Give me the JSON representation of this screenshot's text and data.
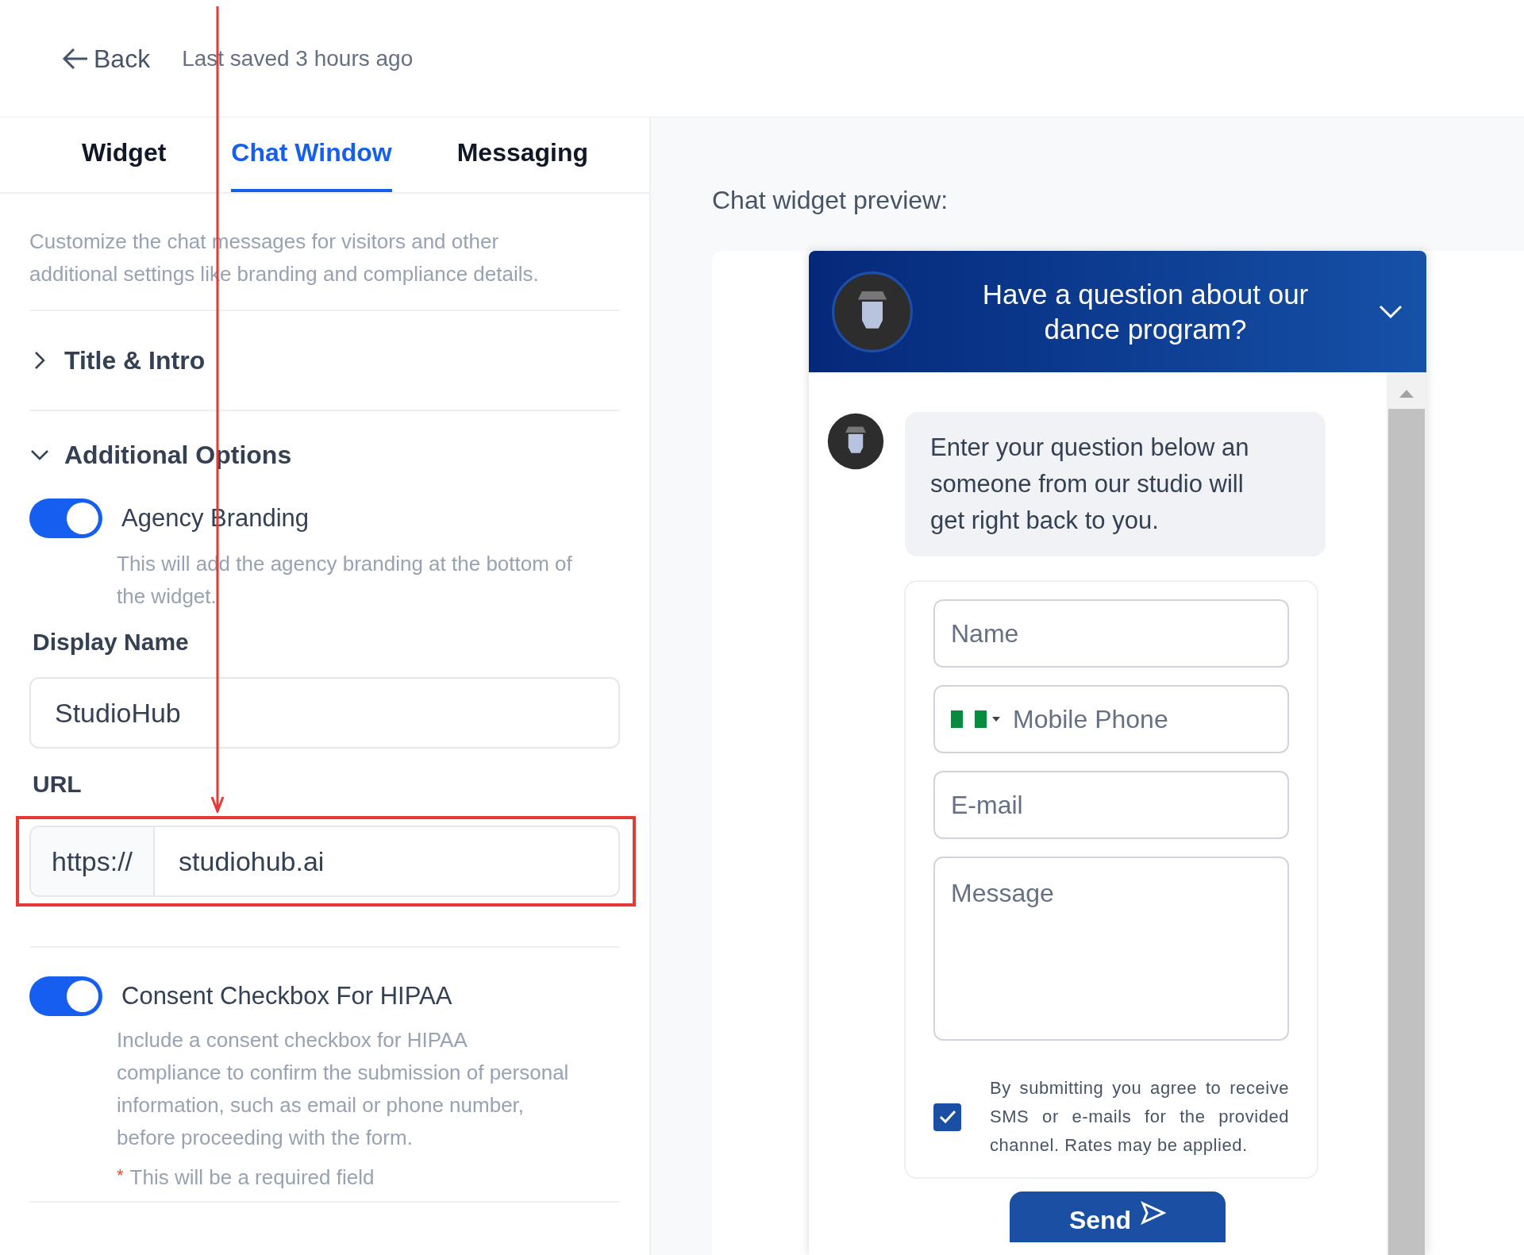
{
  "header": {
    "back": "Back",
    "saved": "Last saved 3 hours ago"
  },
  "tabs": [
    {
      "label": "Widget",
      "selected": false
    },
    {
      "label": "Chat Window",
      "selected": true
    },
    {
      "label": "Messaging",
      "selected": false
    }
  ],
  "intro": "Customize the chat messages for visitors and other additional settings like branding and compliance details.",
  "sections": [
    {
      "title": "Title & Intro",
      "expanded": false
    },
    {
      "title": "Additional Options",
      "expanded": true
    }
  ],
  "agency_branding": {
    "label": "Agency Branding",
    "on": true,
    "description": "This will add the agency branding at the bottom of the widget."
  },
  "display_name": {
    "label": "Display Name",
    "value": "StudioHub"
  },
  "url": {
    "label": "URL",
    "prefix": "https://",
    "value": "studiohub.ai"
  },
  "hipaa": {
    "label": "Consent Checkbox For HIPAA",
    "on": true,
    "description": "Include a consent checkbox for HIPAA compliance to confirm the submission of personal information, such as email or phone number, before proceeding with the form.",
    "required_mark": "*",
    "required_note": "This will be a required field"
  },
  "preview": {
    "title": "Chat widget preview:",
    "header": "Have a question about our dance program?",
    "message": "Enter your question below an someone from our studio will get right back to you.",
    "fields": [
      {
        "kind": "text",
        "placeholder": "Name"
      },
      {
        "kind": "phone",
        "placeholder": "Mobile Phone"
      },
      {
        "kind": "text",
        "placeholder": "E-mail"
      },
      {
        "kind": "textarea",
        "placeholder": "Message"
      }
    ],
    "consent": {
      "checked": true,
      "text": "By submitting you agree to receive SMS or e-mails for the provided channel. Rates may be applied."
    },
    "send": "Send"
  }
}
